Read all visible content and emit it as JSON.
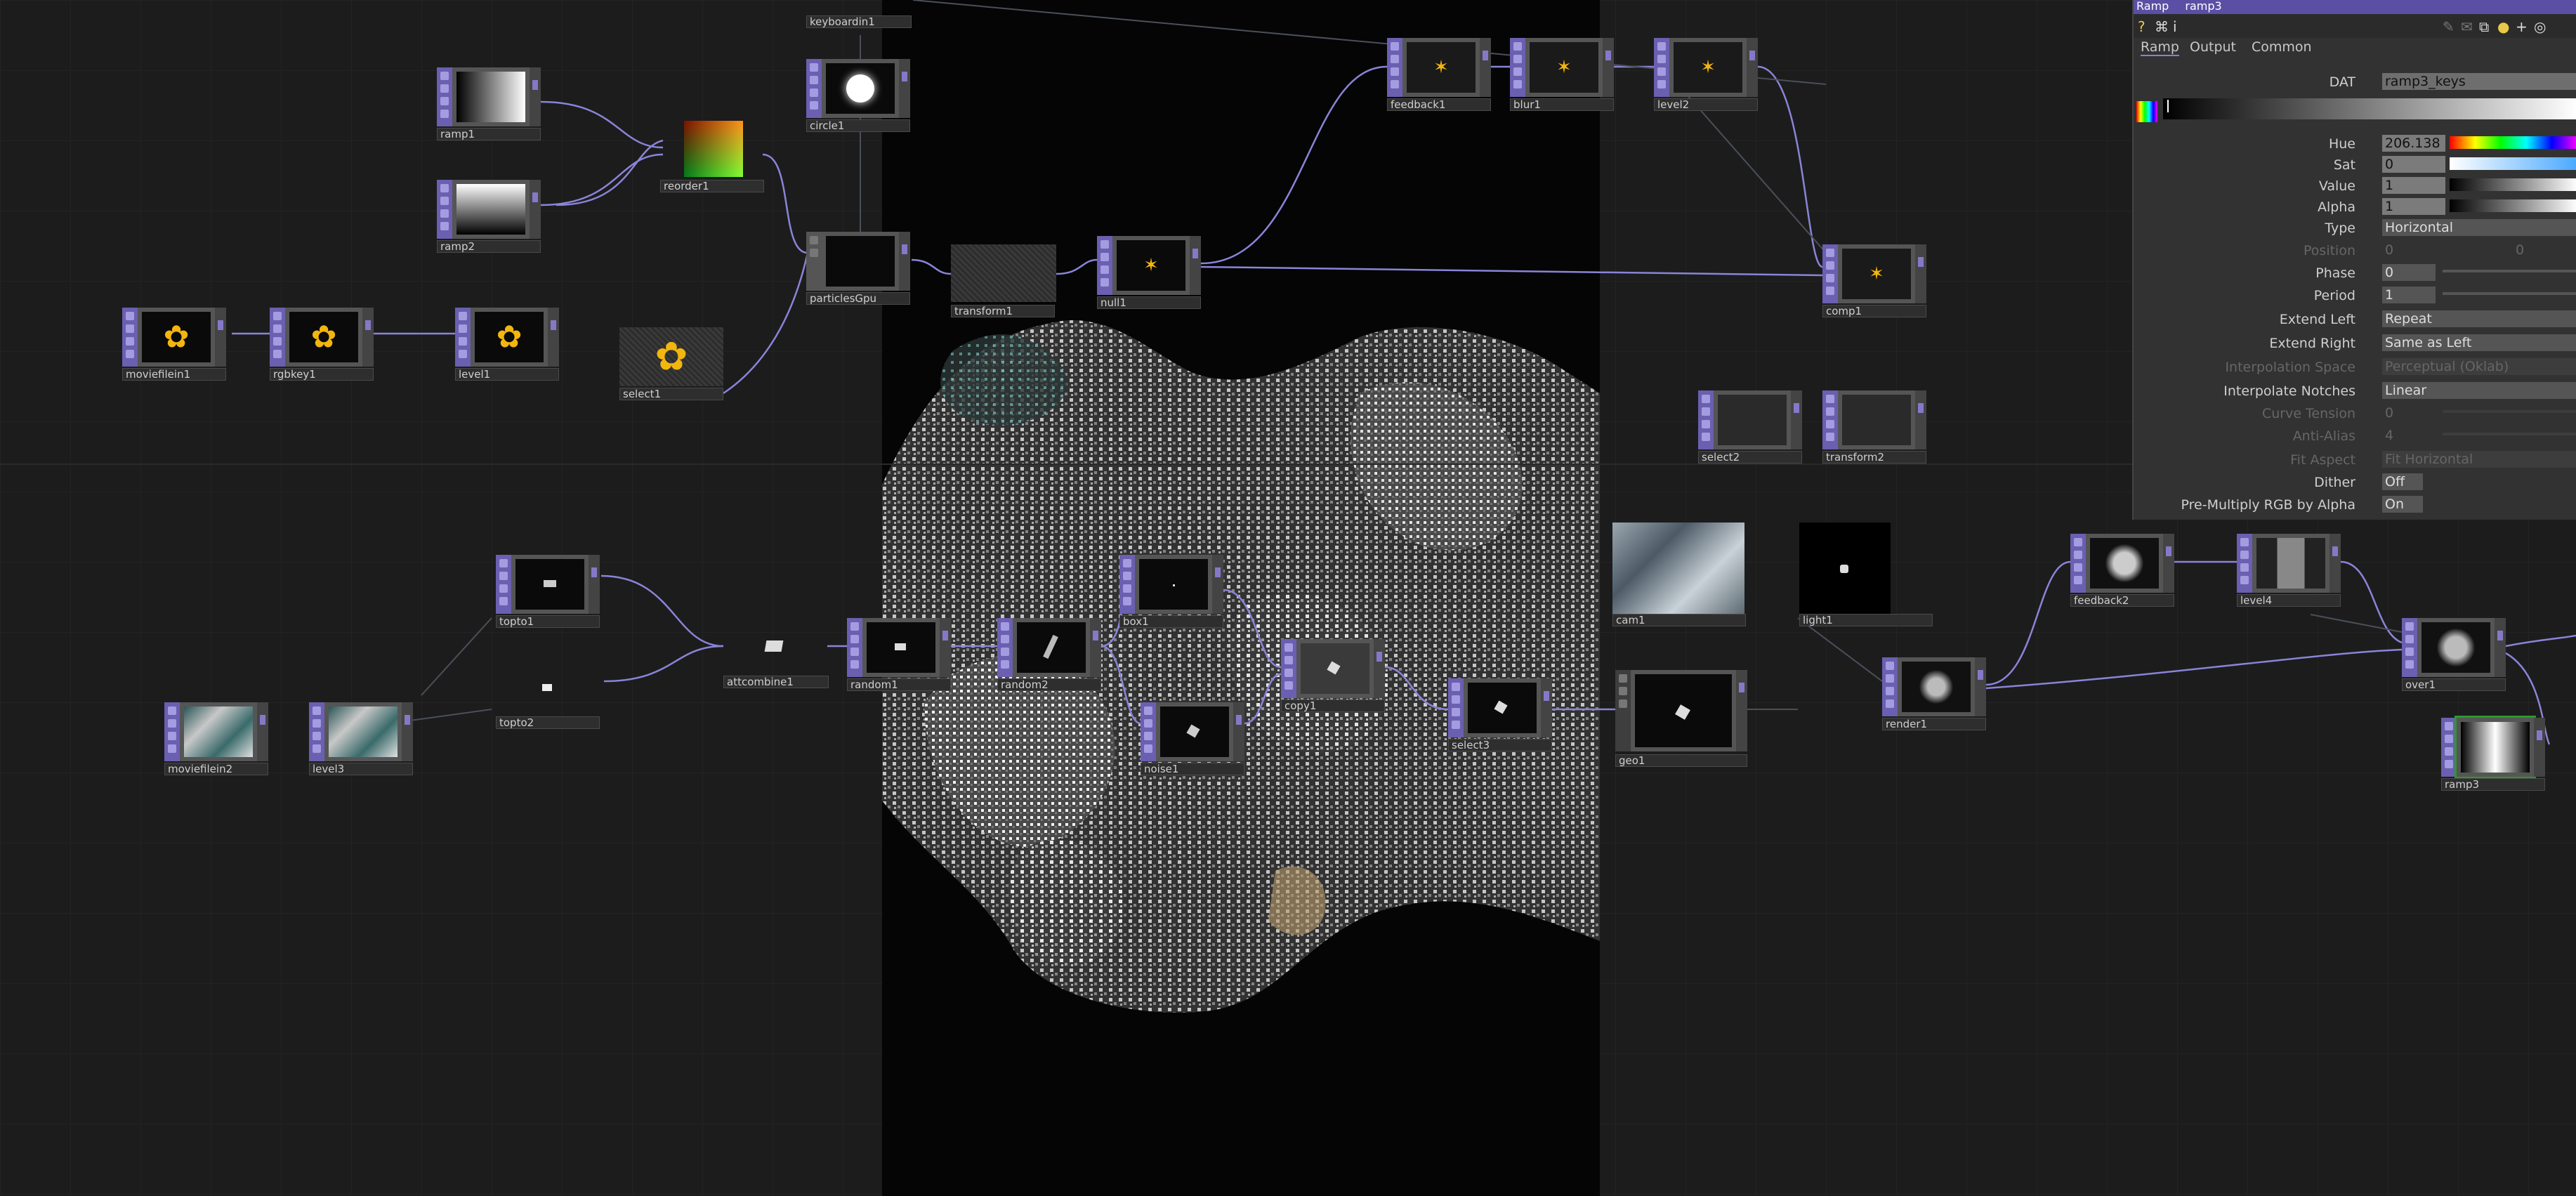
{
  "nodes": [
    {
      "id": "keyboardin1",
      "label": "keyboardin1"
    },
    {
      "id": "ramp1",
      "label": "ramp1"
    },
    {
      "id": "ramp2",
      "label": "ramp2"
    },
    {
      "id": "reorder1",
      "label": "reorder1"
    },
    {
      "id": "circle1",
      "label": "circle1"
    },
    {
      "id": "particlesGpu",
      "label": "particlesGpu"
    },
    {
      "id": "transform1",
      "label": "transform1"
    },
    {
      "id": "null1",
      "label": "null1"
    },
    {
      "id": "feedback1",
      "label": "feedback1"
    },
    {
      "id": "blur1",
      "label": "blur1"
    },
    {
      "id": "level2",
      "label": "level2"
    },
    {
      "id": "comp1",
      "label": "comp1"
    },
    {
      "id": "moviefilein1",
      "label": "moviefilein1"
    },
    {
      "id": "rgbkey1",
      "label": "rgbkey1"
    },
    {
      "id": "level1",
      "label": "level1"
    },
    {
      "id": "select1",
      "label": "select1"
    },
    {
      "id": "select2",
      "label": "select2"
    },
    {
      "id": "transform2",
      "label": "transform2"
    },
    {
      "id": "topto1",
      "label": "topto1"
    },
    {
      "id": "topto2",
      "label": "topto2"
    },
    {
      "id": "moviefilein2",
      "label": "moviefilein2"
    },
    {
      "id": "level3",
      "label": "level3"
    },
    {
      "id": "attcombine1",
      "label": "attcombine1"
    },
    {
      "id": "random1",
      "label": "random1"
    },
    {
      "id": "random2",
      "label": "random2"
    },
    {
      "id": "box1",
      "label": "box1"
    },
    {
      "id": "noise1",
      "label": "noise1"
    },
    {
      "id": "copy1",
      "label": "copy1"
    },
    {
      "id": "select3",
      "label": "select3"
    },
    {
      "id": "geo1",
      "label": "geo1"
    },
    {
      "id": "cam1",
      "label": "cam1"
    },
    {
      "id": "light1",
      "label": "light1"
    },
    {
      "id": "render1",
      "label": "render1"
    },
    {
      "id": "feedback2",
      "label": "feedback2"
    },
    {
      "id": "level4",
      "label": "level4"
    },
    {
      "id": "over1",
      "label": "over1"
    },
    {
      "id": "ramp3",
      "label": "ramp3"
    }
  ],
  "panel": {
    "header_type": "Ramp",
    "header_name": "ramp3",
    "tabs": [
      "Ramp",
      "Output",
      "Common"
    ],
    "active_tab": "Ramp",
    "dat_label": "DAT",
    "dat_value": "ramp3_keys",
    "params": [
      {
        "label": "Hue",
        "value": "206.138",
        "enabled": true
      },
      {
        "label": "Sat",
        "value": "0",
        "enabled": true
      },
      {
        "label": "Value",
        "value": "1",
        "enabled": true
      },
      {
        "label": "Alpha",
        "value": "1",
        "enabled": true
      },
      {
        "label": "Type",
        "value": "Horizontal",
        "enabled": true
      },
      {
        "label": "Position",
        "value": "0",
        "value2": "0",
        "enabled": false
      },
      {
        "label": "Phase",
        "value": "0",
        "enabled": true
      },
      {
        "label": "Period",
        "value": "1",
        "enabled": true
      },
      {
        "label": "Extend Left",
        "value": "Repeat",
        "enabled": true
      },
      {
        "label": "Extend Right",
        "value": "Same as Left",
        "enabled": true
      },
      {
        "label": "Interpolation Space",
        "value": "Perceptual (Oklab)",
        "enabled": false
      },
      {
        "label": "Interpolate Notches",
        "value": "Linear",
        "enabled": true
      },
      {
        "label": "Curve Tension",
        "value": "0",
        "enabled": false
      },
      {
        "label": "Anti-Alias",
        "value": "4",
        "enabled": false
      },
      {
        "label": "Fit Aspect",
        "value": "Fit Horizontal",
        "enabled": false
      },
      {
        "label": "Dither",
        "value": "Off",
        "enabled": true
      },
      {
        "label": "Pre-Multiply RGB by Alpha",
        "value": "On",
        "enabled": true
      }
    ]
  },
  "colors": {
    "accent": "#6a5fb0",
    "selected": "#2a9a2a",
    "wire": "#8a84d8"
  }
}
